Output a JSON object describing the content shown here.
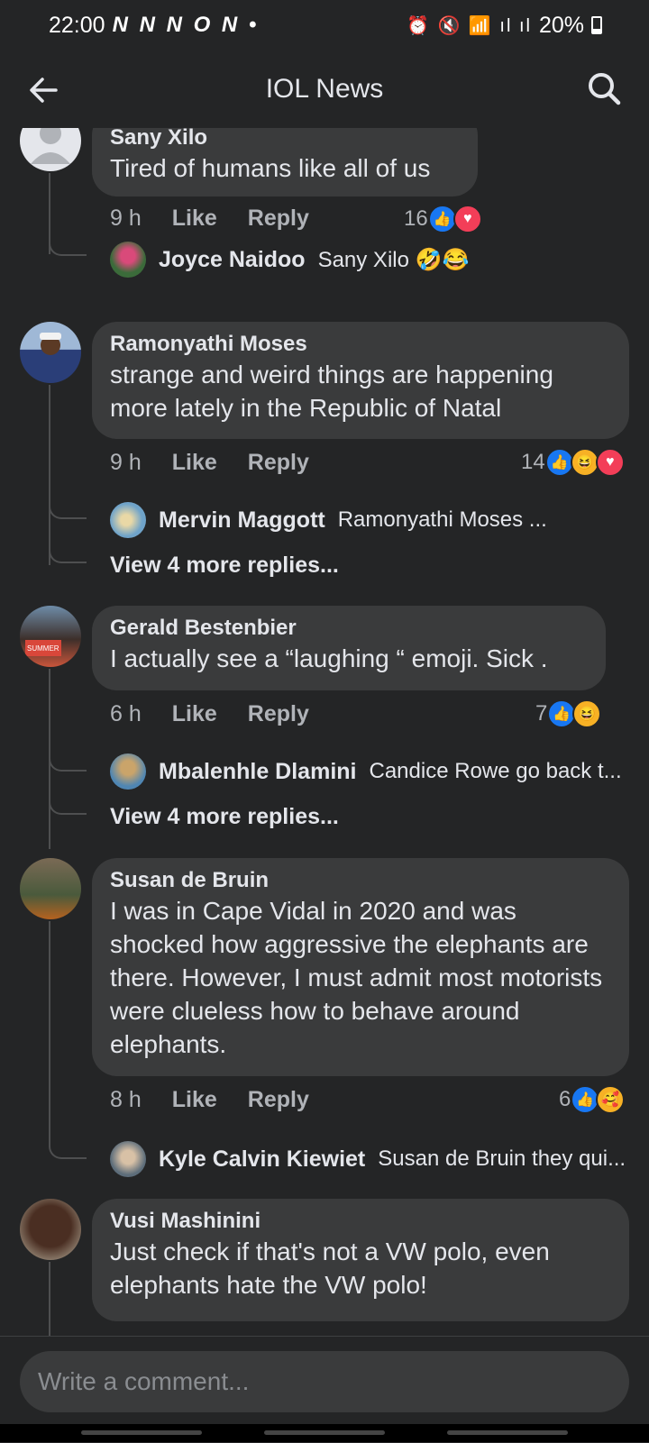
{
  "status_bar": {
    "time": "22:00",
    "notifications": "N N N O N •",
    "icons": "⏰ 🔇 📶 ıl ıl",
    "battery": "20%"
  },
  "header": {
    "title": "IOL News"
  },
  "comments": [
    {
      "author": "Sany Xilo",
      "text": "Tired of humans like all of us",
      "time": "9 h",
      "like_label": "Like",
      "reply_label": "Reply",
      "reaction_count": "16",
      "reactions": [
        "like",
        "love"
      ],
      "replies": [
        {
          "author": "Joyce Naidoo",
          "text": "Sany Xilo 🤣😂"
        }
      ]
    },
    {
      "author": "Ramonyathi Moses",
      "text": "strange and weird things are happening more lately in the Republic of Natal",
      "time": "9 h",
      "like_label": "Like",
      "reply_label": "Reply",
      "reaction_count": "14",
      "reactions": [
        "like",
        "haha",
        "love"
      ],
      "replies": [
        {
          "author": "Mervin Maggott",
          "text": "Ramonyathi Moses ..."
        }
      ],
      "more_replies": "View 4 more replies..."
    },
    {
      "author": "Gerald Bestenbier",
      "text": "I actually see a “laughing “ emoji. Sick .",
      "time": "6 h",
      "like_label": "Like",
      "reply_label": "Reply",
      "reaction_count": "7",
      "reactions": [
        "like",
        "haha"
      ],
      "replies": [
        {
          "author": "Mbalenhle Dlamini",
          "text": "Candice Rowe go back t..."
        }
      ],
      "more_replies": "View 4 more replies..."
    },
    {
      "author": "Susan de Bruin",
      "text": "I was in Cape Vidal in 2020 and was shocked how aggressive the elephants are there. However, I must admit most motorists were clueless how to behave around elephants.",
      "time": "8 h",
      "like_label": "Like",
      "reply_label": "Reply",
      "reaction_count": "6",
      "reactions": [
        "like",
        "care"
      ],
      "replies": [
        {
          "author": "Kyle Calvin Kiewiet",
          "text": "Susan de Bruin they qui..."
        }
      ]
    },
    {
      "author": "Vusi Mashinini",
      "text": "Just check if that's not a VW polo, even elephants hate the VW  polo!"
    }
  ],
  "composer": {
    "placeholder": "Write a comment..."
  },
  "colors": {
    "background": "#242526",
    "bubble": "#3a3b3c",
    "like_blue": "#1877f2",
    "love_red": "#f33e58",
    "haha_yellow": "#f7b125"
  }
}
